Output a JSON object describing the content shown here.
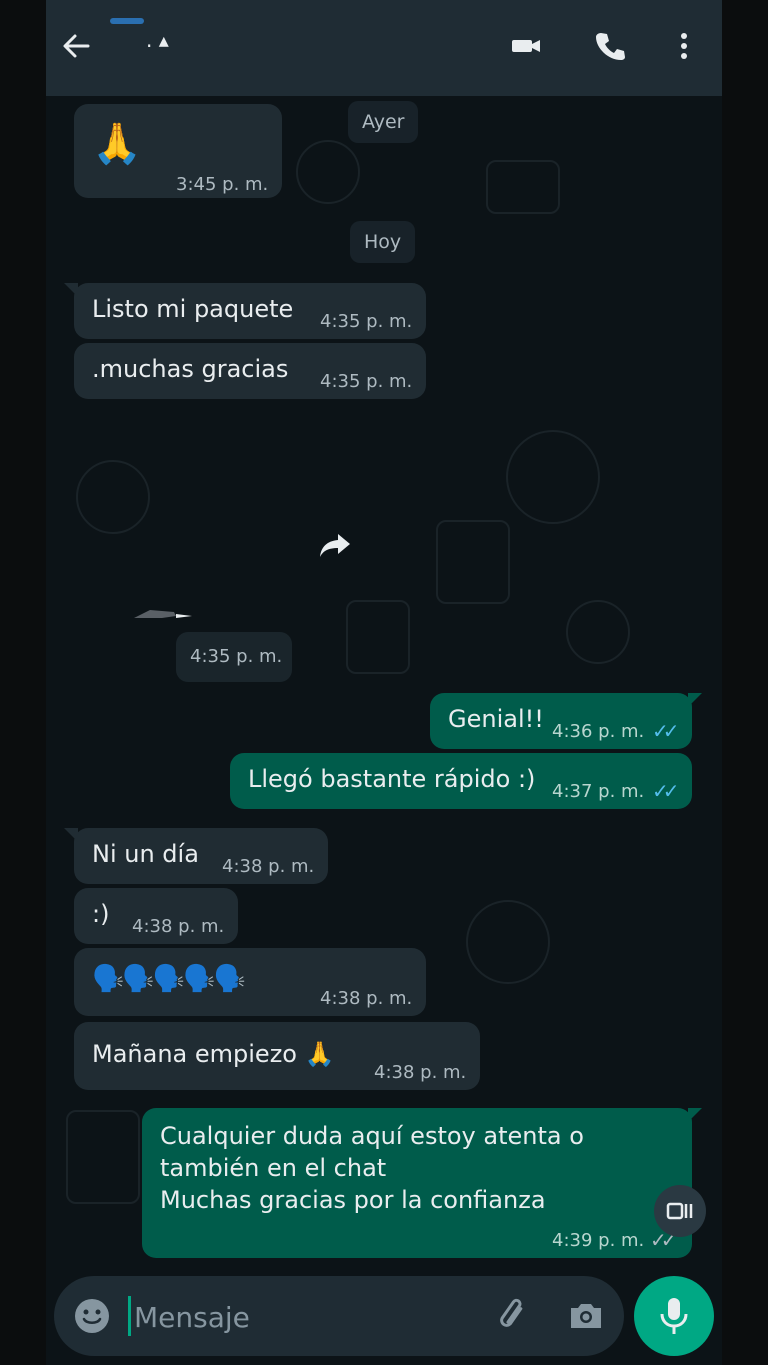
{
  "header": {
    "contact_name": ". ▴",
    "icons": [
      "back-arrow-icon",
      "video-call-icon",
      "phone-icon",
      "more-vertical-icon"
    ]
  },
  "dates": {
    "yesterday": "Ayer",
    "today": "Hoy"
  },
  "messages": [
    {
      "dir": "in",
      "text": "🙏",
      "time": "3:45 p. m."
    },
    {
      "dir": "in",
      "text": "Listo mi paquete",
      "time": "4:35 p. m."
    },
    {
      "dir": "in",
      "text": ".muchas gracias",
      "time": "4:35 p. m."
    },
    {
      "dir": "in",
      "text": "",
      "time": "4:35 p. m.",
      "type": "media"
    },
    {
      "dir": "out",
      "text": "Genial!!",
      "time": "4:36 p. m.",
      "status": "read"
    },
    {
      "dir": "out",
      "text": "Llegó bastante rápido :)",
      "time": "4:37 p. m.",
      "status": "read"
    },
    {
      "dir": "in",
      "text": "Ni un día",
      "time": "4:38 p. m."
    },
    {
      "dir": "in",
      "text": ":)",
      "time": "4:38 p. m."
    },
    {
      "dir": "in",
      "text": "🗣️🗣️🗣️🗣️🗣️",
      "time": "4:38 p. m."
    },
    {
      "dir": "in",
      "text": "Mañana empiezo 🙏",
      "time": "4:38 p. m."
    },
    {
      "dir": "out",
      "text": "Cualquier duda aquí estoy atenta o\ntambién en el chat\nMuchas gracias por la confianza",
      "time": "4:39 p. m.",
      "status": "sent"
    }
  ],
  "composer": {
    "placeholder": "Mensaje",
    "icons": [
      "emoji-icon",
      "attach-icon",
      "camera-icon",
      "mic-icon"
    ]
  },
  "colors": {
    "header_bg": "#1f2c34",
    "chat_bg": "#0c1317",
    "incoming_bubble": "#202c33",
    "outgoing_bubble": "#005c4b",
    "accent": "#00a884",
    "read_ticks": "#53bdeb"
  }
}
